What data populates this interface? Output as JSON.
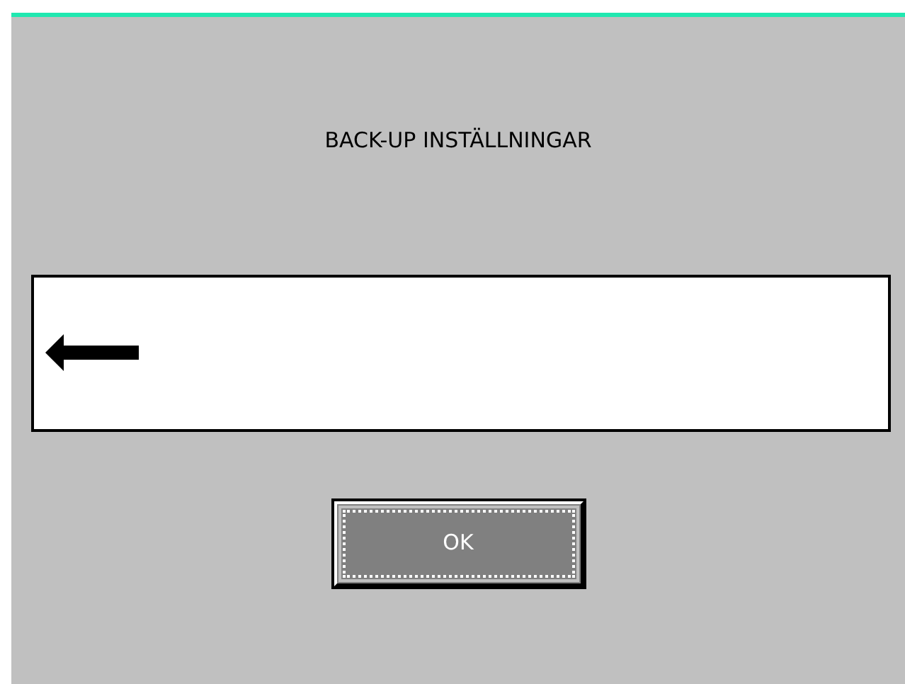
{
  "window": {
    "title": "BACK-UP INSTÄLLNINGAR"
  },
  "buttons": [
    {
      "label": "OK",
      "focused": true
    }
  ]
}
